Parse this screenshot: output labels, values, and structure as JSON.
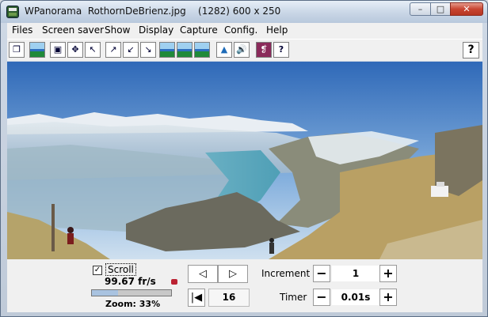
{
  "window": {
    "app_name": "WPanorama",
    "file_name": "RothornDeBrienz.jpg",
    "dims": "(1282) 600 x 250",
    "min_label": "–",
    "max_label": "□",
    "close_label": "✕"
  },
  "menu": [
    "Files",
    "Screen saver",
    "Show",
    "Display",
    "Capture",
    "Config.",
    "Help"
  ],
  "toolbar": {
    "tools": [
      {
        "name": "open-file-icon",
        "glyph": "❐"
      },
      {
        "name": "picture-icon",
        "glyph": ""
      },
      {
        "name": "fit-window-icon",
        "glyph": "▣"
      },
      {
        "name": "expand-icon",
        "glyph": "✥"
      },
      {
        "name": "shrink-icon",
        "glyph": "↖"
      },
      {
        "name": "move-up-right-icon",
        "glyph": "↗"
      },
      {
        "name": "move-down-left-icon",
        "glyph": "↙"
      },
      {
        "name": "move-down-right-icon",
        "glyph": "↘"
      },
      {
        "name": "panorama-view-1-icon",
        "glyph": ""
      },
      {
        "name": "panorama-view-2-icon",
        "glyph": ""
      },
      {
        "name": "panorama-view-3-icon",
        "glyph": ""
      },
      {
        "name": "landscape-icon",
        "glyph": "▲"
      },
      {
        "name": "sound-icon",
        "glyph": "🔊"
      },
      {
        "name": "book-icon",
        "glyph": "❡"
      },
      {
        "name": "help-topics-icon",
        "glyph": "?"
      }
    ],
    "help": "?"
  },
  "controls": {
    "scroll_checked": "✓",
    "scroll_label": "Scroll",
    "fps": "99.67 fr/s",
    "zoom_label": "Zoom: 33%",
    "zoom_fraction": 0.33,
    "prev_glyph": "◁",
    "next_glyph": "▷",
    "first_glyph": "|◀",
    "frame": "16",
    "increment_label": "Increment",
    "increment_value": "1",
    "timer_label": "Timer",
    "timer_value": "0.01s",
    "minus": "−",
    "plus": "+"
  }
}
